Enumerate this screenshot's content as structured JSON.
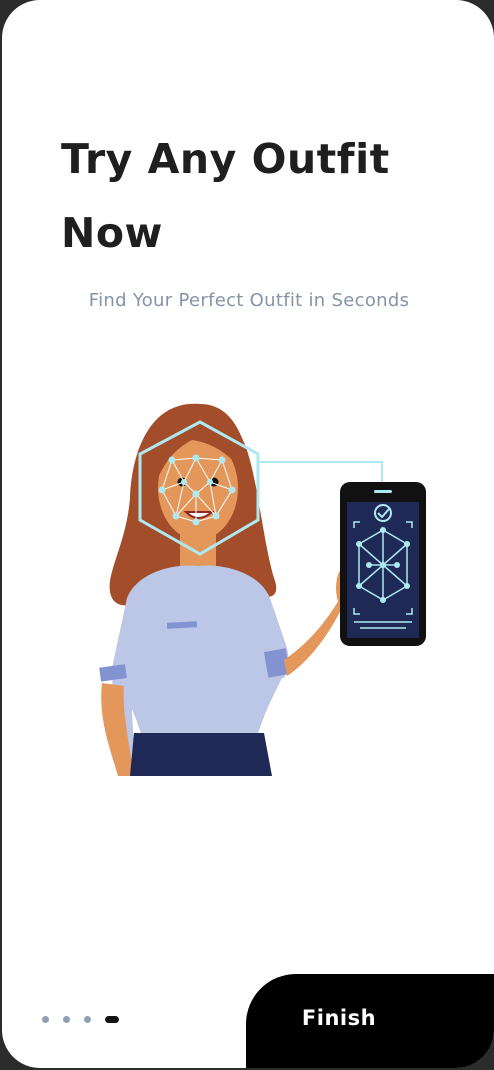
{
  "onboarding": {
    "title": "Try Any Outfit Now",
    "subtitle": "Find Your Perfect Outfit in Seconds",
    "illustration_icon": "face-scan-illustration",
    "pagination": {
      "total": 4,
      "current": 4
    },
    "finish_label": "Finish"
  }
}
